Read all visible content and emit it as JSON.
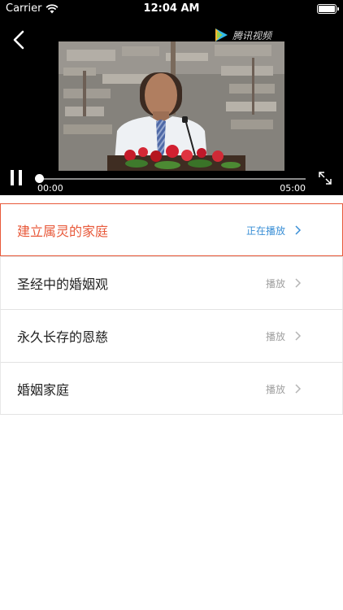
{
  "status_bar": {
    "carrier": "Carrier",
    "time": "12:04 AM"
  },
  "player": {
    "logo_text": "腾讯视频",
    "current_time": "00:00",
    "total_time": "05:00",
    "progress": 0.0
  },
  "playlist": [
    {
      "title": "建立属灵的家庭",
      "status": "正在播放",
      "active": true
    },
    {
      "title": "圣经中的婚姻观",
      "status": "播放",
      "active": false
    },
    {
      "title": "永久长存的恩慈",
      "status": "播放",
      "active": false
    },
    {
      "title": "婚姻家庭",
      "status": "播放",
      "active": false
    }
  ],
  "colors": {
    "accent": "#e8593a",
    "playing_status": "#3a8fd6",
    "muted_text": "#a0a0a0"
  },
  "icons": {
    "back": "chevron-left-icon",
    "pause": "pause-icon",
    "fullscreen": "fullscreen-icon",
    "row_chevron": "chevron-right-icon",
    "logo": "tencent-video-logo-icon",
    "wifi": "wifi-icon",
    "battery": "battery-icon"
  }
}
